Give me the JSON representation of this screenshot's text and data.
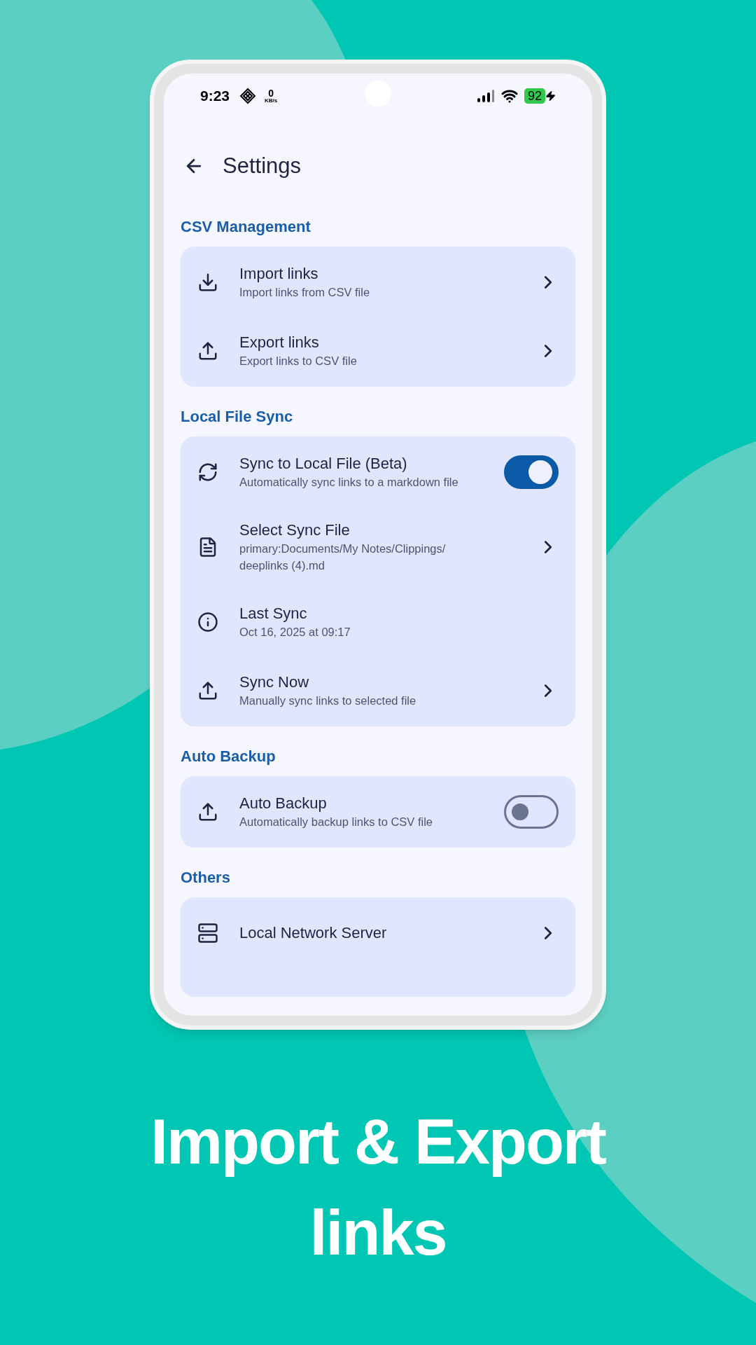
{
  "status_bar": {
    "time": "9:23",
    "net_speed_value": "0",
    "net_speed_unit": "KB/s",
    "battery": "92",
    "charging": true
  },
  "header": {
    "title": "Settings"
  },
  "sections": [
    {
      "title": "CSV Management",
      "items": [
        {
          "kind": "link",
          "title": "Import links",
          "subtitle": "Import links from CSV file"
        },
        {
          "kind": "link",
          "title": "Export links",
          "subtitle": "Export links to CSV file"
        }
      ]
    },
    {
      "title": "Local File Sync",
      "items": [
        {
          "kind": "toggle",
          "title": "Sync to Local File (Beta)",
          "subtitle": "Automatically sync links to a markdown file",
          "on": true
        },
        {
          "kind": "link",
          "title": "Select Sync File",
          "subtitle": "primary:Documents/My Notes/Clippings/ deeplinks (4).md"
        },
        {
          "kind": "info",
          "title": "Last Sync",
          "subtitle": "Oct 16, 2025 at 09:17"
        },
        {
          "kind": "link",
          "title": "Sync Now",
          "subtitle": "Manually sync links to selected file"
        }
      ]
    },
    {
      "title": "Auto Backup",
      "items": [
        {
          "kind": "toggle",
          "title": "Auto Backup",
          "subtitle": "Automatically backup links to CSV file",
          "on": false
        }
      ]
    },
    {
      "title": "Others",
      "items": [
        {
          "kind": "link",
          "title": "Local Network Server"
        }
      ]
    }
  ],
  "caption": "Import & Export links"
}
